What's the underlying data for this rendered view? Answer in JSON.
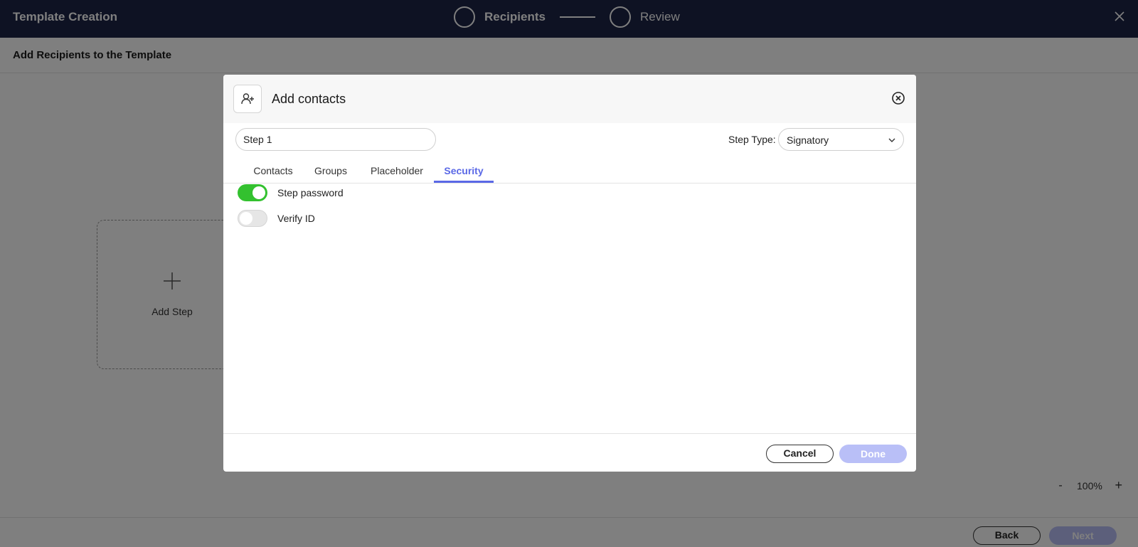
{
  "app": {
    "title": "Template Creation",
    "steps": [
      {
        "label": "Recipients",
        "active": true
      },
      {
        "label": "Review",
        "active": false
      }
    ]
  },
  "subheader": {
    "title": "Add Recipients to the Template"
  },
  "canvas": {
    "add_step_label": "Add Step",
    "zoom": {
      "minus": "-",
      "value": "100%",
      "plus": "+"
    }
  },
  "footer": {
    "back_label": "Back",
    "next_label": "Next"
  },
  "modal": {
    "title": "Add contacts",
    "step_name_value": "Step 1",
    "step_type_label": "Step Type:",
    "step_type_value": "Signatory",
    "tabs": [
      {
        "label": "Contacts",
        "active": false
      },
      {
        "label": "Groups",
        "active": false
      },
      {
        "label": "Placeholder",
        "active": false
      },
      {
        "label": "Security",
        "active": true
      }
    ],
    "security": {
      "step_password": {
        "label": "Step password",
        "enabled": true
      },
      "verify_id": {
        "label": "Verify ID",
        "enabled": false
      }
    },
    "cancel_label": "Cancel",
    "done_label": "Done"
  },
  "colors": {
    "topbar": "#1c2447",
    "accent": "#5a68e6",
    "toggle_on": "#33c12f",
    "disabled_button": "#b9bff7"
  }
}
